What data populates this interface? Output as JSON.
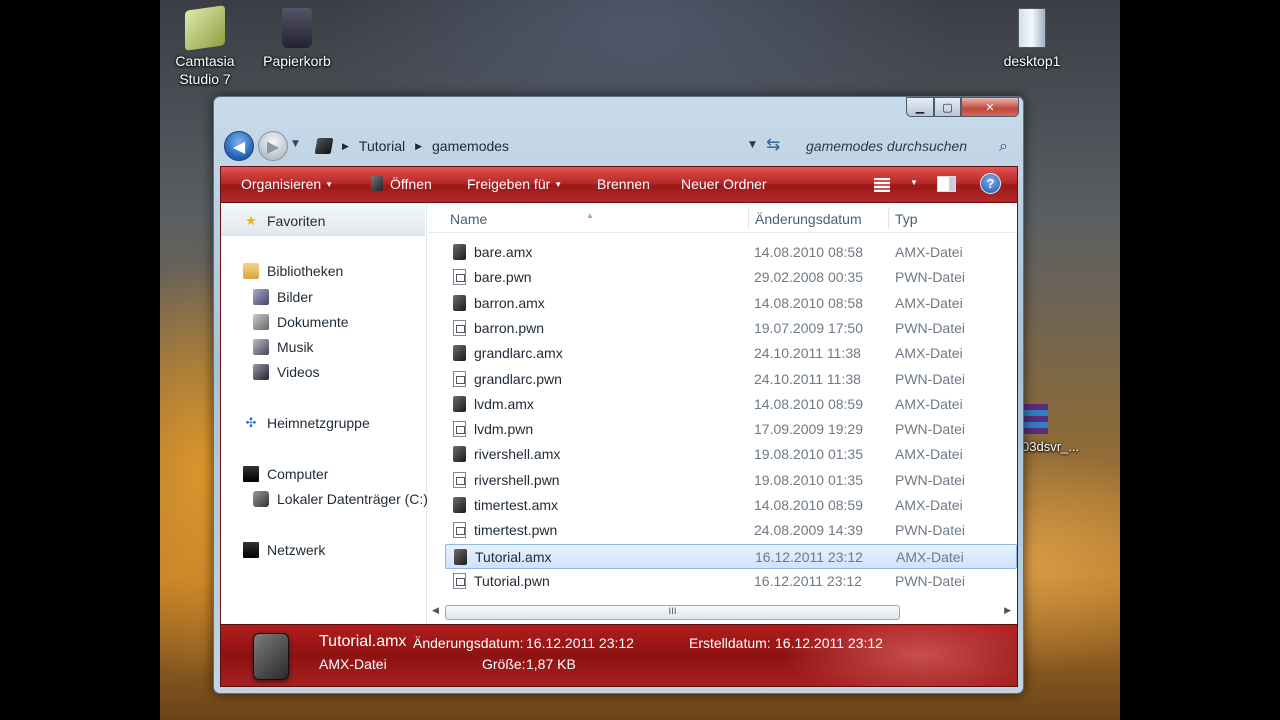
{
  "desktop": {
    "icons": [
      {
        "label_line1": "Camtasia",
        "label_line2": "Studio 7"
      },
      {
        "label_line1": "Papierkorb",
        "label_line2": ""
      },
      {
        "label_line1": "desktop1",
        "label_line2": ""
      },
      {
        "label_line1": "03dsvr_...",
        "label_line2": ""
      }
    ]
  },
  "window": {
    "caption_buttons": {
      "minimize": "▁",
      "maximize": "▢",
      "close": "✕"
    },
    "address": {
      "segments": [
        "Tutorial",
        "gamemodes"
      ]
    },
    "search": {
      "placeholder": "gamemodes durchsuchen"
    }
  },
  "toolbar": {
    "organize": "Organisieren",
    "open": "Öffnen",
    "share": "Freigeben für",
    "burn": "Brennen",
    "new_folder": "Neuer Ordner",
    "help": "?"
  },
  "navpane": {
    "favorites": "Favoriten",
    "libraries": "Bibliotheken",
    "pictures": "Bilder",
    "documents": "Dokumente",
    "music": "Musik",
    "videos": "Videos",
    "homegroup": "Heimnetzgruppe",
    "computer": "Computer",
    "local_disk": "Lokaler Datenträger (C:)",
    "network": "Netzwerk"
  },
  "filelist": {
    "columns": {
      "name": "Name",
      "date": "Änderungsdatum",
      "type": "Typ"
    },
    "rows": [
      {
        "name": "bare.amx",
        "date": "14.08.2010 08:58",
        "type": "AMX-Datei",
        "kind": "amx"
      },
      {
        "name": "bare.pwn",
        "date": "29.02.2008 00:35",
        "type": "PWN-Datei",
        "kind": "pwn"
      },
      {
        "name": "barron.amx",
        "date": "14.08.2010 08:58",
        "type": "AMX-Datei",
        "kind": "amx"
      },
      {
        "name": "barron.pwn",
        "date": "19.07.2009 17:50",
        "type": "PWN-Datei",
        "kind": "pwn"
      },
      {
        "name": "grandlarc.amx",
        "date": "24.10.2011 11:38",
        "type": "AMX-Datei",
        "kind": "amx"
      },
      {
        "name": "grandlarc.pwn",
        "date": "24.10.2011 11:38",
        "type": "PWN-Datei",
        "kind": "pwn"
      },
      {
        "name": "lvdm.amx",
        "date": "14.08.2010 08:59",
        "type": "AMX-Datei",
        "kind": "amx"
      },
      {
        "name": "lvdm.pwn",
        "date": "17.09.2009 19:29",
        "type": "PWN-Datei",
        "kind": "pwn"
      },
      {
        "name": "rivershell.amx",
        "date": "19.08.2010 01:35",
        "type": "AMX-Datei",
        "kind": "amx"
      },
      {
        "name": "rivershell.pwn",
        "date": "19.08.2010 01:35",
        "type": "PWN-Datei",
        "kind": "pwn"
      },
      {
        "name": "timertest.amx",
        "date": "14.08.2010 08:59",
        "type": "AMX-Datei",
        "kind": "amx"
      },
      {
        "name": "timertest.pwn",
        "date": "24.08.2009 14:39",
        "type": "PWN-Datei",
        "kind": "pwn"
      },
      {
        "name": "Tutorial.amx",
        "date": "16.12.2011 23:12",
        "type": "AMX-Datei",
        "kind": "amx",
        "selected": true
      },
      {
        "name": "Tutorial.pwn",
        "date": "16.12.2011 23:12",
        "type": "PWN-Datei",
        "kind": "pwn"
      }
    ],
    "scroll_thumb": "III"
  },
  "details": {
    "filename": "Tutorial.amx",
    "filetype": "AMX-Datei",
    "modified_label": "Änderungsdatum:",
    "modified_value": "16.12.2011 23:12",
    "size_label": "Größe:",
    "size_value": "1,87 KB",
    "created_label": "Erstelldatum:",
    "created_value": "16.12.2011 23:12"
  }
}
